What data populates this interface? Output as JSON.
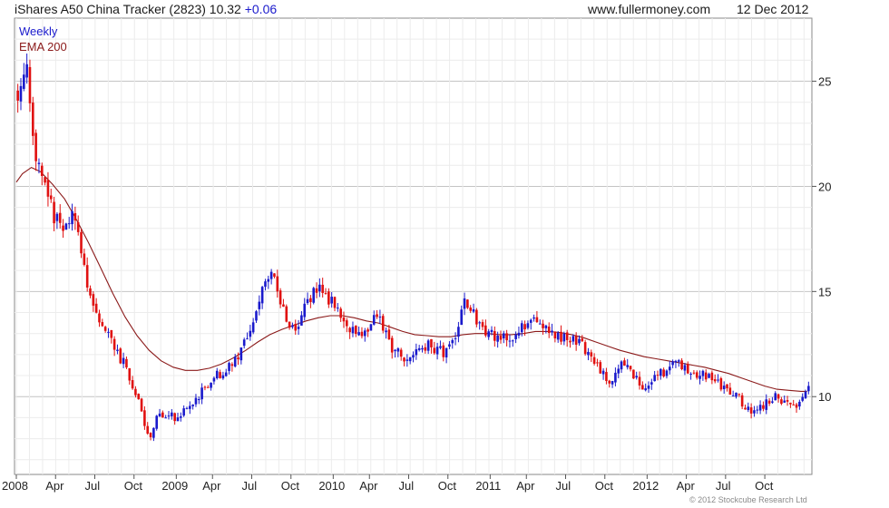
{
  "header": {
    "title": "iShares A50 China Tracker (2823)",
    "last": "10.32",
    "change": "+0.06",
    "site": "www.fullermoney.com",
    "date": "12 Dec 2012"
  },
  "copyright": "© 2012 Stockcube Research Ltd",
  "colors": {
    "up": "#1a1acc",
    "down": "#e01010",
    "ema": "#8b1a1a",
    "grid": "#d8d8d8",
    "axis": "#555555"
  },
  "chart_data": {
    "type": "candlestick",
    "legend": [
      "Weekly",
      "EMA 200"
    ],
    "legend_position": "top-left",
    "grid": true,
    "ylim": [
      6.3,
      28
    ],
    "y_ticks": [
      10,
      15,
      20,
      25
    ],
    "y_axis_side": "right",
    "x_ticks": [
      {
        "label": "2008",
        "wk": 0
      },
      {
        "label": "Apr",
        "wk": 13
      },
      {
        "label": "Jul",
        "wk": 26
      },
      {
        "label": "Oct",
        "wk": 39
      },
      {
        "label": "2009",
        "wk": 53
      },
      {
        "label": "Apr",
        "wk": 65
      },
      {
        "label": "Jul",
        "wk": 78
      },
      {
        "label": "Oct",
        "wk": 91
      },
      {
        "label": "2010",
        "wk": 105
      },
      {
        "label": "Apr",
        "wk": 117
      },
      {
        "label": "Jul",
        "wk": 130
      },
      {
        "label": "Oct",
        "wk": 143
      },
      {
        "label": "2011",
        "wk": 157
      },
      {
        "label": "Apr",
        "wk": 169
      },
      {
        "label": "Jul",
        "wk": 182
      },
      {
        "label": "Oct",
        "wk": 195
      },
      {
        "label": "2012",
        "wk": 209
      },
      {
        "label": "Apr",
        "wk": 222
      },
      {
        "label": "Jul",
        "wk": 235
      },
      {
        "label": "Oct",
        "wk": 248
      }
    ],
    "weeks": 263,
    "price_path": [
      [
        0,
        24.5
      ],
      [
        3,
        25.5
      ],
      [
        6,
        21.5
      ],
      [
        9,
        20.0
      ],
      [
        12,
        18.5
      ],
      [
        15,
        18.0
      ],
      [
        18,
        18.5
      ],
      [
        21,
        17.0
      ],
      [
        24,
        14.5
      ],
      [
        27,
        13.5
      ],
      [
        30,
        13.0
      ],
      [
        33,
        12.0
      ],
      [
        36,
        11.5
      ],
      [
        38,
        10.5
      ],
      [
        40,
        9.8
      ],
      [
        42,
        8.5
      ],
      [
        44,
        8.0
      ],
      [
        46,
        9.0
      ],
      [
        49,
        9.2
      ],
      [
        52,
        9.0
      ],
      [
        55,
        9.4
      ],
      [
        58,
        9.8
      ],
      [
        62,
        10.4
      ],
      [
        66,
        11.0
      ],
      [
        70,
        11.4
      ],
      [
        74,
        12.2
      ],
      [
        78,
        13.5
      ],
      [
        81,
        15.0
      ],
      [
        84,
        16.2
      ],
      [
        86,
        15.2
      ],
      [
        88,
        14.0
      ],
      [
        90,
        13.3
      ],
      [
        92,
        13.2
      ],
      [
        95,
        14.4
      ],
      [
        98,
        15.0
      ],
      [
        100,
        15.1
      ],
      [
        103,
        14.7
      ],
      [
        106,
        14.3
      ],
      [
        109,
        13.3
      ],
      [
        112,
        13.0
      ],
      [
        116,
        13.3
      ],
      [
        119,
        13.8
      ],
      [
        121,
        13.3
      ],
      [
        124,
        12.3
      ],
      [
        127,
        11.9
      ],
      [
        130,
        11.8
      ],
      [
        133,
        12.3
      ],
      [
        136,
        12.5
      ],
      [
        139,
        12.2
      ],
      [
        142,
        12.1
      ],
      [
        145,
        12.6
      ],
      [
        148,
        14.5
      ],
      [
        150,
        14.2
      ],
      [
        152,
        13.5
      ],
      [
        155,
        13.0
      ],
      [
        158,
        12.9
      ],
      [
        162,
        12.8
      ],
      [
        165,
        13.0
      ],
      [
        168,
        13.3
      ],
      [
        171,
        13.8
      ],
      [
        173,
        13.5
      ],
      [
        176,
        13.2
      ],
      [
        179,
        12.9
      ],
      [
        182,
        12.8
      ],
      [
        185,
        12.7
      ],
      [
        188,
        12.3
      ],
      [
        191,
        11.6
      ],
      [
        194,
        11.2
      ],
      [
        196,
        10.5
      ],
      [
        198,
        11.3
      ],
      [
        200,
        11.6
      ],
      [
        203,
        11.2
      ],
      [
        206,
        10.6
      ],
      [
        209,
        10.5
      ],
      [
        212,
        11.0
      ],
      [
        215,
        11.2
      ],
      [
        218,
        11.7
      ],
      [
        221,
        11.4
      ],
      [
        224,
        11.0
      ],
      [
        227,
        11.2
      ],
      [
        230,
        10.8
      ],
      [
        233,
        10.5
      ],
      [
        236,
        10.1
      ],
      [
        239,
        9.9
      ],
      [
        242,
        9.4
      ],
      [
        245,
        9.3
      ],
      [
        248,
        9.7
      ],
      [
        251,
        10.0
      ],
      [
        254,
        9.8
      ],
      [
        257,
        9.6
      ],
      [
        260,
        9.8
      ],
      [
        262,
        10.32
      ]
    ],
    "ema_path": [
      [
        0,
        20.2
      ],
      [
        2,
        20.6
      ],
      [
        5,
        20.9
      ],
      [
        8,
        20.7
      ],
      [
        12,
        20.1
      ],
      [
        16,
        19.4
      ],
      [
        20,
        18.4
      ],
      [
        24,
        17.3
      ],
      [
        28,
        16.1
      ],
      [
        32,
        14.9
      ],
      [
        36,
        13.8
      ],
      [
        40,
        12.9
      ],
      [
        44,
        12.2
      ],
      [
        48,
        11.7
      ],
      [
        52,
        11.4
      ],
      [
        56,
        11.25
      ],
      [
        60,
        11.25
      ],
      [
        64,
        11.35
      ],
      [
        68,
        11.55
      ],
      [
        72,
        11.85
      ],
      [
        76,
        12.2
      ],
      [
        80,
        12.6
      ],
      [
        84,
        12.95
      ],
      [
        88,
        13.2
      ],
      [
        92,
        13.4
      ],
      [
        96,
        13.6
      ],
      [
        100,
        13.75
      ],
      [
        104,
        13.85
      ],
      [
        108,
        13.85
      ],
      [
        112,
        13.75
      ],
      [
        116,
        13.6
      ],
      [
        120,
        13.5
      ],
      [
        124,
        13.3
      ],
      [
        128,
        13.1
      ],
      [
        132,
        12.95
      ],
      [
        136,
        12.9
      ],
      [
        140,
        12.85
      ],
      [
        144,
        12.85
      ],
      [
        148,
        12.95
      ],
      [
        152,
        13.0
      ],
      [
        156,
        13.0
      ],
      [
        160,
        12.95
      ],
      [
        164,
        12.95
      ],
      [
        168,
        13.0
      ],
      [
        172,
        13.1
      ],
      [
        176,
        13.1
      ],
      [
        180,
        13.05
      ],
      [
        184,
        12.95
      ],
      [
        188,
        12.8
      ],
      [
        192,
        12.6
      ],
      [
        196,
        12.4
      ],
      [
        200,
        12.2
      ],
      [
        204,
        12.05
      ],
      [
        208,
        11.9
      ],
      [
        212,
        11.8
      ],
      [
        216,
        11.7
      ],
      [
        220,
        11.6
      ],
      [
        224,
        11.5
      ],
      [
        228,
        11.4
      ],
      [
        232,
        11.25
      ],
      [
        236,
        11.1
      ],
      [
        240,
        10.9
      ],
      [
        244,
        10.7
      ],
      [
        248,
        10.5
      ],
      [
        252,
        10.35
      ],
      [
        256,
        10.3
      ],
      [
        260,
        10.25
      ],
      [
        262,
        10.25
      ]
    ]
  }
}
